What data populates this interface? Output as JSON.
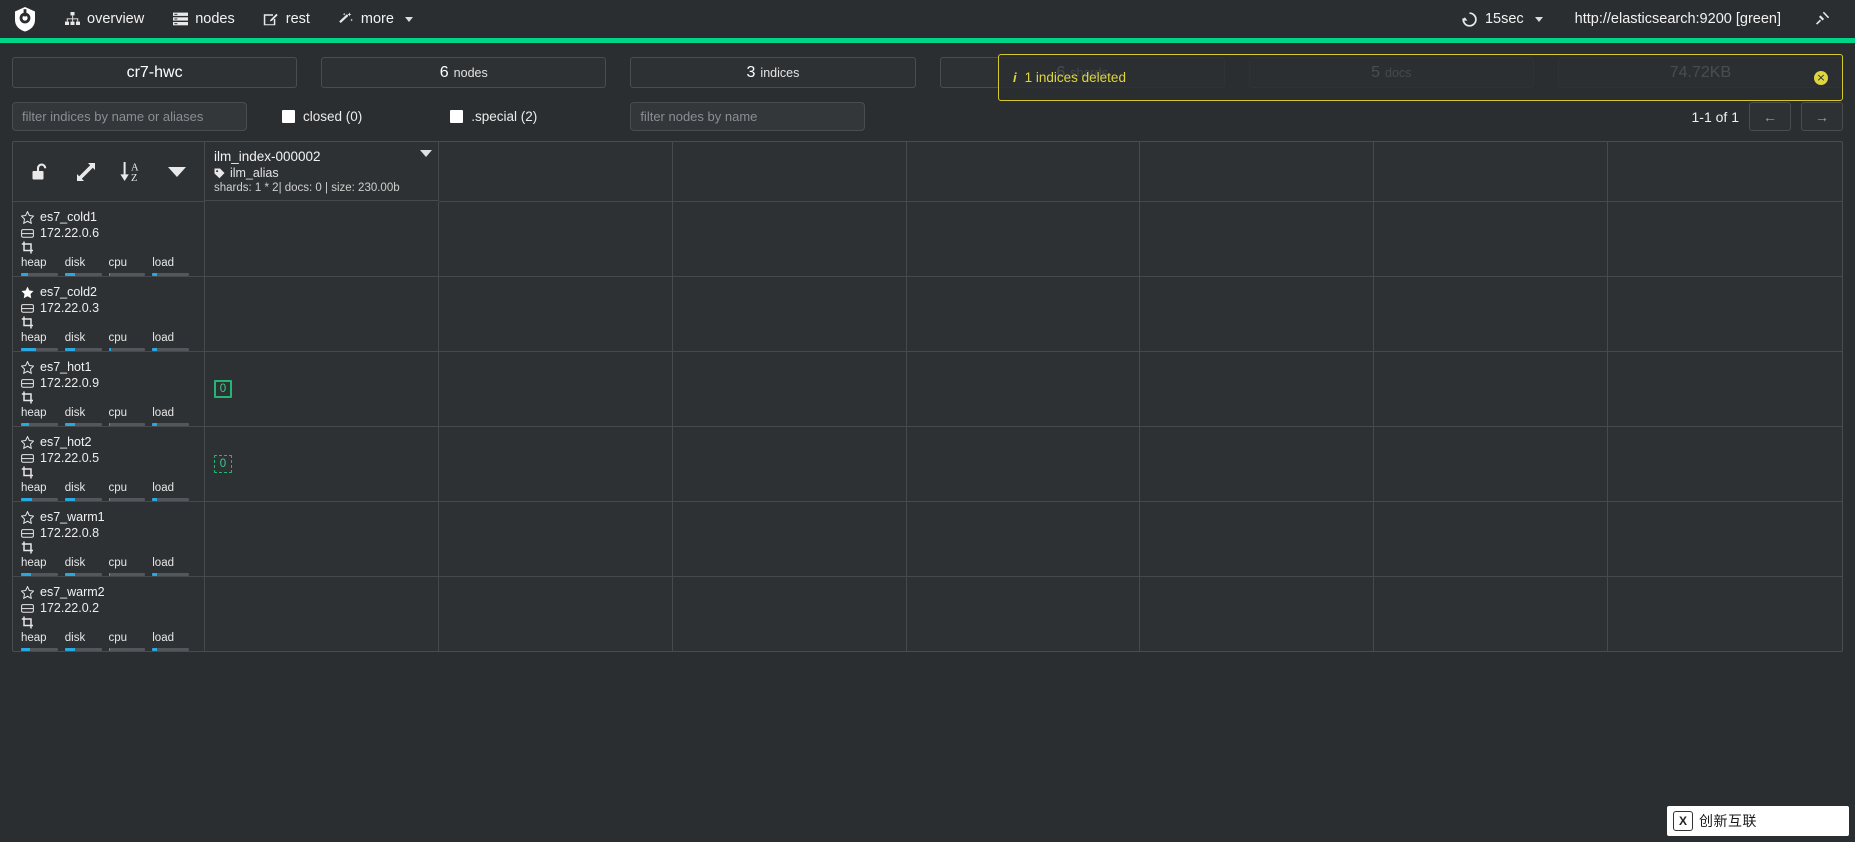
{
  "navbar": {
    "brand_icon": "cerebro-logo-icon",
    "items": [
      {
        "label": "overview",
        "icon": "sitemap-icon"
      },
      {
        "label": "nodes",
        "icon": "server-list-icon"
      },
      {
        "label": "rest",
        "icon": "edit-square-icon"
      },
      {
        "label": "more",
        "icon": "magic-wand-icon",
        "has_caret": true
      }
    ],
    "refresh": {
      "label": "15sec",
      "icon": "refresh-icon",
      "has_caret": true
    },
    "cluster_url": "http://elasticsearch:9200 [green]",
    "disconnect_icon": "plug-icon"
  },
  "health": {
    "status": "green",
    "color": "#00d486"
  },
  "stats": [
    {
      "num": "cr7-hwc",
      "unit": "",
      "name": "cluster-name"
    },
    {
      "num": "6",
      "unit": "nodes",
      "name": "nodes-count"
    },
    {
      "num": "3",
      "unit": "indices",
      "name": "indices-count"
    },
    {
      "num": "6",
      "unit": "shards",
      "name": "shards-count"
    },
    {
      "num": "5",
      "unit": "docs",
      "name": "docs-count"
    },
    {
      "num": "74.72KB",
      "unit": "",
      "name": "storage-size"
    }
  ],
  "alert": {
    "icon": "info-icon",
    "message": "1 indices deleted",
    "close_label": "×",
    "color": "#ded63f"
  },
  "filters": {
    "indices_placeholder": "filter indices by name or aliases",
    "indices_value": "",
    "closed_label": "closed (0)",
    "closed_checked": false,
    "special_label": ".special (2)",
    "special_checked": false,
    "nodes_placeholder": "filter nodes by name",
    "nodes_value": ""
  },
  "pager": {
    "range_label": "1-1 of 1",
    "prev_label": "←",
    "next_label": "→"
  },
  "toolbar": {
    "buttons": [
      {
        "name": "unlock-icon",
        "title": "toggle lock"
      },
      {
        "name": "expand-arrows-icon",
        "title": "expand"
      },
      {
        "name": "sort-az-icon",
        "title": "sort a-z"
      },
      {
        "name": "filter-caret-icon",
        "title": "filter"
      }
    ]
  },
  "index": {
    "name": "ilm_index-000002",
    "alias": "ilm_alias",
    "alias_icon": "tag-icon",
    "meta": "shards: 1 * 2| docs: 0 | size: 230.00b",
    "caret_icon": "caret-down-icon"
  },
  "nodes": [
    {
      "name": "es7_cold1",
      "ip": "172.22.0.6",
      "master": false,
      "star_icon": "star-outline-icon",
      "ip_icon": "server-icon",
      "role_icon": "data-node-icon",
      "metrics": [
        {
          "label": "heap",
          "pct": 19
        },
        {
          "label": "disk",
          "pct": 28
        },
        {
          "label": "cpu",
          "pct": 4
        },
        {
          "label": "load",
          "pct": 14
        }
      ],
      "shard": null
    },
    {
      "name": "es7_cold2",
      "ip": "172.22.0.3",
      "master": true,
      "star_icon": "star-filled-icon",
      "ip_icon": "server-icon",
      "role_icon": "data-node-icon",
      "metrics": [
        {
          "label": "heap",
          "pct": 42
        },
        {
          "label": "disk",
          "pct": 28
        },
        {
          "label": "cpu",
          "pct": 6
        },
        {
          "label": "load",
          "pct": 14
        }
      ],
      "shard": null
    },
    {
      "name": "es7_hot1",
      "ip": "172.22.0.9",
      "master": false,
      "star_icon": "star-outline-icon",
      "ip_icon": "server-icon",
      "role_icon": "data-node-icon",
      "metrics": [
        {
          "label": "heap",
          "pct": 22
        },
        {
          "label": "disk",
          "pct": 28
        },
        {
          "label": "cpu",
          "pct": 4
        },
        {
          "label": "load",
          "pct": 14
        }
      ],
      "shard": {
        "label": "0",
        "type": "primary"
      }
    },
    {
      "name": "es7_hot2",
      "ip": "172.22.0.5",
      "master": false,
      "star_icon": "star-outline-icon",
      "ip_icon": "server-icon",
      "role_icon": "data-node-icon",
      "metrics": [
        {
          "label": "heap",
          "pct": 30
        },
        {
          "label": "disk",
          "pct": 28
        },
        {
          "label": "cpu",
          "pct": 4
        },
        {
          "label": "load",
          "pct": 14
        }
      ],
      "shard": {
        "label": "0",
        "type": "replica"
      }
    },
    {
      "name": "es7_warm1",
      "ip": "172.22.0.8",
      "master": false,
      "star_icon": "star-outline-icon",
      "ip_icon": "server-icon",
      "role_icon": "data-node-icon",
      "metrics": [
        {
          "label": "heap",
          "pct": 26
        },
        {
          "label": "disk",
          "pct": 28
        },
        {
          "label": "cpu",
          "pct": 4
        },
        {
          "label": "load",
          "pct": 14
        }
      ],
      "shard": null
    },
    {
      "name": "es7_warm2",
      "ip": "172.22.0.2",
      "master": false,
      "star_icon": "star-outline-icon",
      "ip_icon": "server-icon",
      "role_icon": "data-node-icon",
      "metrics": [
        {
          "label": "heap",
          "pct": 24
        },
        {
          "label": "disk",
          "pct": 28
        },
        {
          "label": "cpu",
          "pct": 4
        },
        {
          "label": "load",
          "pct": 14
        }
      ],
      "shard": null
    }
  ],
  "watermark": {
    "text": "创新互联",
    "logo": "X"
  }
}
